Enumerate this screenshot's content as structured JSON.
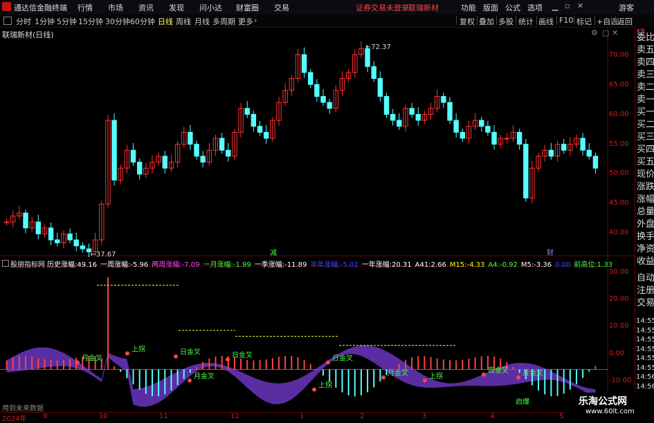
{
  "titlebar": {
    "app_name": "通达信金融终端",
    "menus": [
      "行情",
      "市场",
      "资讯",
      "发现",
      "问小达",
      "财富圈",
      "交易"
    ],
    "warning": "证券交易未登录",
    "stock_name": "联瑞新材",
    "right_menus": [
      "功能",
      "版面",
      "公式",
      "选项"
    ],
    "user": "游客"
  },
  "toolbar": {
    "periods": [
      "分时",
      "1分钟",
      "5分钟",
      "15分钟",
      "30分钟",
      "60分钟",
      "日线",
      "周线",
      "月线",
      "多周期",
      "更多"
    ],
    "active_period": "日线",
    "buttons": [
      "复权",
      "叠加",
      "多股",
      "统计",
      "画线",
      "F10",
      "标记",
      "+自选",
      "返回"
    ]
  },
  "chart_header": {
    "title": "联瑞新材(日线)"
  },
  "right_panel": {
    "top": "KR",
    "items": [
      "委比",
      "卖五",
      "卖四",
      "卖三",
      "卖二",
      "卖一",
      "买一",
      "买二",
      "买三",
      "买四",
      "买五",
      "现价",
      "涨跌",
      "涨幅",
      "总量",
      "外盘",
      "换手",
      "净资",
      "收益",
      "自动",
      "注册",
      "交易"
    ]
  },
  "colors": {
    "up": "#ff3333",
    "down": "#54ffff",
    "axis": "#d02020",
    "bg": "#000000"
  },
  "chart_data": [
    {
      "type": "candlestick",
      "title": "联瑞新材(日线)",
      "y_ticks": [
        "70.00",
        "65.00",
        "60.00",
        "55.00",
        "50.00",
        "45.00",
        "40.00"
      ],
      "ylim": [
        37,
        74
      ],
      "high_annotation": "72.37",
      "low_annotation": "37.67",
      "markers": [
        "减",
        "财"
      ],
      "approx_close_path": [
        43,
        44,
        44.5,
        42,
        43,
        41,
        42,
        40,
        39.5,
        41,
        40,
        39,
        38.5,
        38,
        40,
        46,
        60,
        50,
        52,
        55,
        53,
        51,
        52,
        53,
        54,
        52,
        53,
        56,
        58,
        56,
        54,
        53,
        55,
        57,
        55,
        54,
        58,
        62,
        61,
        59,
        58,
        57,
        60,
        63,
        65,
        67,
        71,
        68,
        66,
        64,
        63,
        62,
        65,
        67,
        68,
        71,
        72,
        69,
        67,
        64,
        61,
        60,
        59,
        62,
        61,
        60,
        61,
        62,
        64,
        63,
        60,
        58,
        57,
        59,
        60,
        59,
        58,
        56,
        57,
        57,
        58,
        56,
        47,
        52,
        54,
        55,
        54,
        56,
        55,
        56,
        57,
        55,
        54,
        52
      ]
    },
    {
      "type": "indicator",
      "name": "股朋指标网",
      "y_ticks": [
        "30.00",
        "20.00",
        "10.00",
        "0.00",
        "-10.00"
      ],
      "ylim": [
        -13,
        33
      ],
      "stats": [
        {
          "label": "历史涨幅:",
          "value": "49.16",
          "color": "#ffffff"
        },
        {
          "label": "一周涨幅:",
          "value": "-5.96",
          "color": "#ffffff"
        },
        {
          "label": "两周涨幅:",
          "value": "-7.09",
          "color": "#ff44ff"
        },
        {
          "label": "一月涨幅:",
          "value": "-1.99",
          "color": "#44ff44"
        },
        {
          "label": "一季涨幅:",
          "value": "-11.89",
          "color": "#ffffff"
        },
        {
          "label": "半年涨幅:",
          "value": "-5.02",
          "color": "#4444ff"
        },
        {
          "label": "一年涨幅:",
          "value": "20.31",
          "color": "#ffffff"
        },
        {
          "label": "A41:",
          "value": "2.66",
          "color": "#ffffff"
        },
        {
          "label": "M15:",
          "value": "-4.33",
          "color": "#ffff00"
        },
        {
          "label": "A4:",
          "value": "-0.92",
          "color": "#44ff44"
        },
        {
          "label": "M5:",
          "value": "-3.36",
          "color": "#ffffff"
        },
        {
          "label": "",
          "value": "0.00",
          "color": "#4444ff"
        },
        {
          "label": "前高位:",
          "value": "1.33",
          "color": "#44ff44"
        }
      ],
      "annotations": [
        "日金叉",
        "月金叉",
        "上拐",
        "周金叉",
        "启爆"
      ],
      "right_labels": [
        "14:55",
        "14:55",
        "14:55",
        "14:55",
        "14:55",
        "14:55",
        "14:56",
        "14:56",
        "14:56",
        "14:56"
      ],
      "footer_note": "用到未来数据"
    }
  ],
  "date_axis": {
    "labels": [
      "2024年",
      "9",
      "10",
      "11",
      "12",
      "1",
      "2",
      "3",
      "4",
      "5"
    ]
  },
  "watermark": {
    "name": "乐淘公式网",
    "url": "www.60lt.com"
  }
}
